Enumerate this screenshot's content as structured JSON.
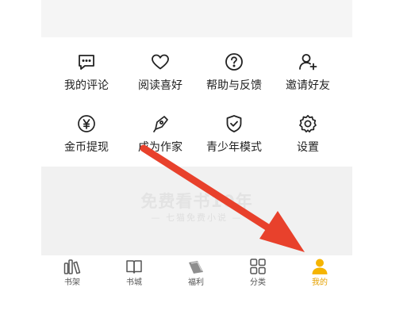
{
  "menu": {
    "row1": [
      {
        "label": "我的评论",
        "icon": "comment-icon"
      },
      {
        "label": "阅读喜好",
        "icon": "heart-icon"
      },
      {
        "label": "帮助与反馈",
        "icon": "help-icon"
      },
      {
        "label": "邀请好友",
        "icon": "add-user-icon"
      }
    ],
    "row2": [
      {
        "label": "金币提现",
        "icon": "coin-icon"
      },
      {
        "label": "成为作家",
        "icon": "pen-icon"
      },
      {
        "label": "青少年模式",
        "icon": "shield-icon"
      },
      {
        "label": "设置",
        "icon": "gear-icon"
      }
    ]
  },
  "banner": {
    "title": "免费看书10年",
    "subtitle": "— 七猫免费小说 —"
  },
  "tabbar": {
    "items": [
      {
        "label": "书架",
        "icon": "bookshelf-icon"
      },
      {
        "label": "书城",
        "icon": "book-icon"
      },
      {
        "label": "福利",
        "icon": "welfare-icon"
      },
      {
        "label": "分类",
        "icon": "category-icon"
      },
      {
        "label": "我的",
        "icon": "profile-icon",
        "active": true
      }
    ]
  },
  "colors": {
    "accent": "#f5b400",
    "active_label": "#e5a100",
    "arrow": "#e8412c",
    "text": "#1f1f1f"
  }
}
